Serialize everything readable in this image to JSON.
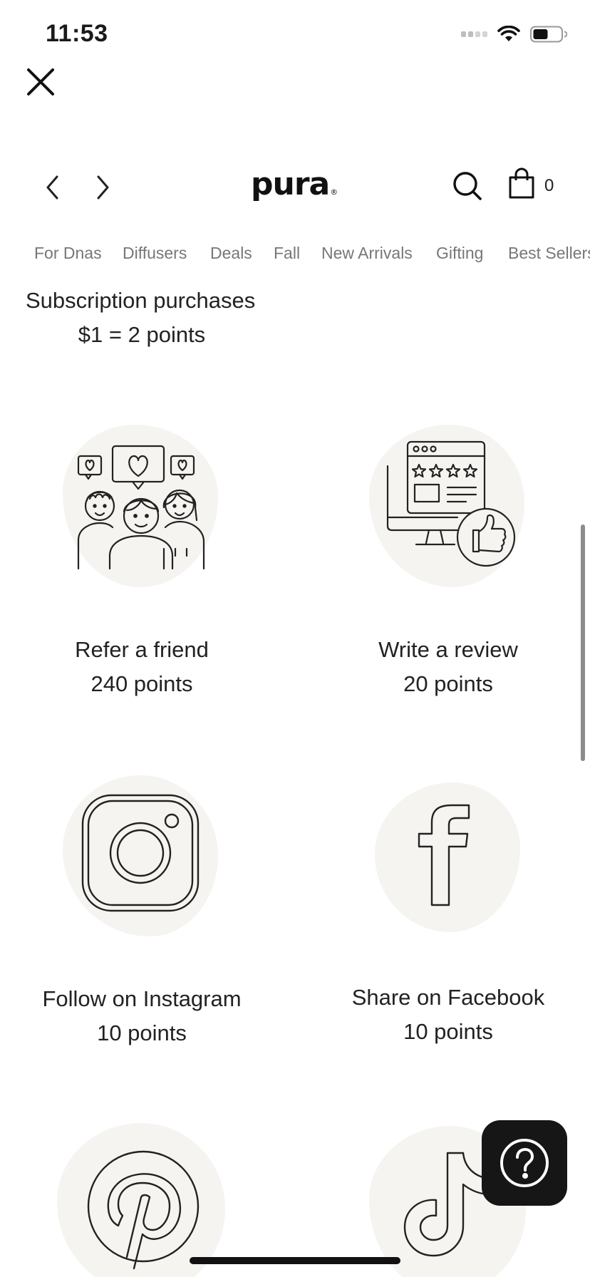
{
  "status": {
    "time": "11:53"
  },
  "header": {
    "logo": "pura",
    "logo_reg": "®",
    "cart_count": "0"
  },
  "categories": [
    "For Dnas",
    "Diffusers",
    "Deals",
    "Fall",
    "New Arrivals",
    "Gifting",
    "Best Sellers"
  ],
  "subscription": {
    "title": "Subscription purchases",
    "value": "$1 = 2 points"
  },
  "rewards": [
    {
      "label": "Refer a friend",
      "points": "240 points",
      "icon": "refer-friends-icon"
    },
    {
      "label": "Write a review",
      "points": "20 points",
      "icon": "review-icon"
    },
    {
      "label": "Follow on Instagram",
      "points": "10 points",
      "icon": "instagram-icon"
    },
    {
      "label": "Share on Facebook",
      "points": "10 points",
      "icon": "facebook-icon"
    },
    {
      "label": "",
      "points": "",
      "icon": "pinterest-icon"
    },
    {
      "label": "",
      "points": "",
      "icon": "tiktok-icon"
    }
  ],
  "colors": {
    "ink": "#1a1a1a",
    "blob": "#f5f4f1",
    "muted_nav": "#777777",
    "help_bg": "#161616"
  }
}
